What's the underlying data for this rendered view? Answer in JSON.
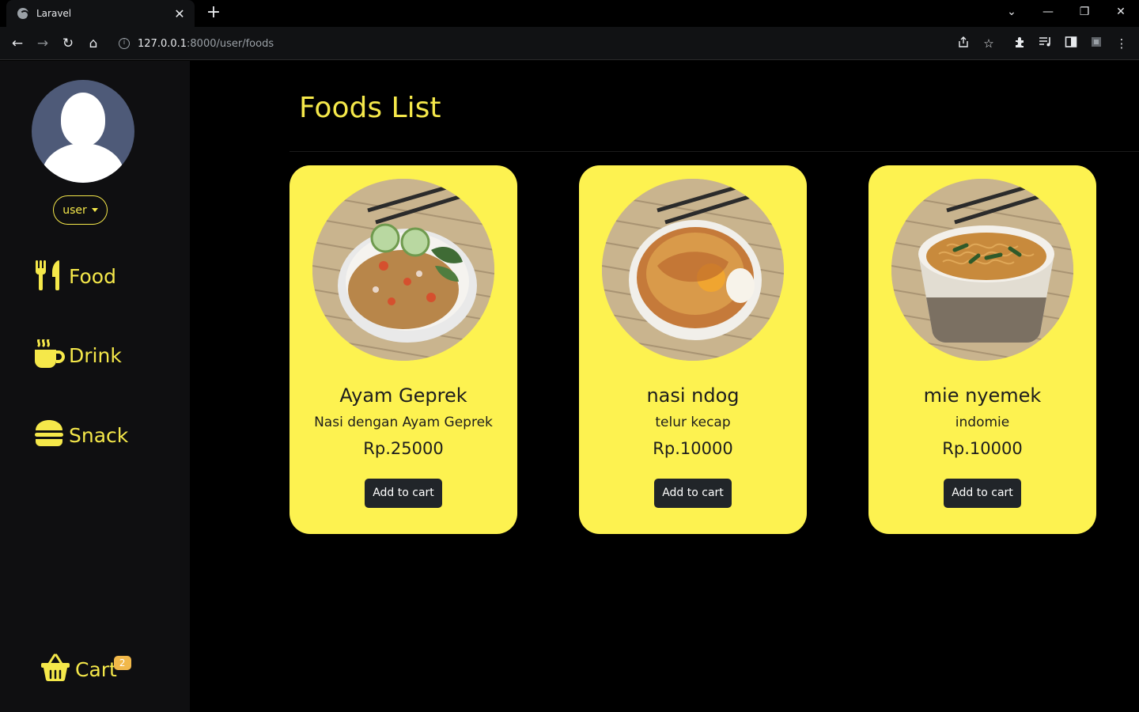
{
  "browser": {
    "tab_title": "Laravel",
    "tab_close": "✕",
    "new_tab": "+",
    "url_host": "127.0.0.1",
    "url_path": ":8000/user/foods",
    "controls": {
      "dropdown": "⌄",
      "minimize": "—",
      "restore": "❐",
      "close": "✕"
    },
    "nav": {
      "back": "←",
      "forward": "→",
      "reload": "↻",
      "home": "⌂"
    }
  },
  "sidebar": {
    "user_label": "user",
    "menu": [
      {
        "label": "Food",
        "icon": "utensils-icon"
      },
      {
        "label": "Drink",
        "icon": "mug-hot-icon"
      },
      {
        "label": "Snack",
        "icon": "burger-icon"
      }
    ],
    "cart": {
      "label": "Cart",
      "count": "2",
      "icon": "basket-icon"
    }
  },
  "main": {
    "title": "Foods List",
    "cards": [
      {
        "name": "Ayam Geprek",
        "description": "Nasi dengan Ayam Geprek",
        "price": "Rp.25000",
        "button": "Add to cart"
      },
      {
        "name": "nasi ndog",
        "description": "telur kecap",
        "price": "Rp.10000",
        "button": "Add to cart"
      },
      {
        "name": "mie nyemek",
        "description": "indomie",
        "price": "Rp.10000",
        "button": "Add to cart"
      }
    ]
  },
  "colors": {
    "accent": "#f5e84a",
    "card": "#fdf250",
    "sidebar": "#0f0f11",
    "button": "#212529"
  }
}
